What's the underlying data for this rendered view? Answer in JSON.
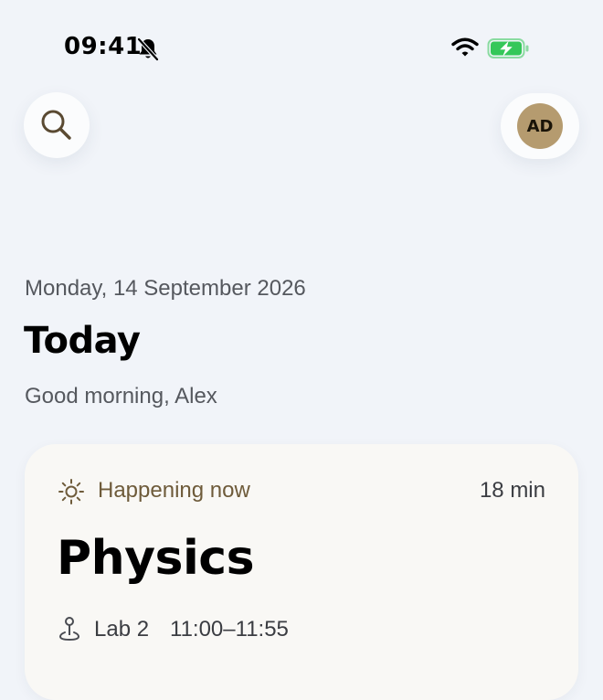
{
  "status_bar": {
    "time": "09:41",
    "icons": [
      "bell-slash-icon",
      "wifi-icon",
      "battery-charging-icon"
    ],
    "battery_color": "#34c759"
  },
  "header": {
    "search_icon": "search-icon",
    "avatar_initials": "AD",
    "avatar_color": "#b59b6f"
  },
  "main": {
    "date": "Monday, 14 September 2026",
    "title": "Today",
    "greeting": "Good morning, Alex"
  },
  "now_card": {
    "status_icon": "sun-icon",
    "status_label": "Happening now",
    "time_remaining": "18 min",
    "class_name": "Physics",
    "location_icon": "map-pin-icon",
    "room": "Lab 2",
    "time_range": "11:00–11:55",
    "accent_color": "#6e5b3a"
  }
}
